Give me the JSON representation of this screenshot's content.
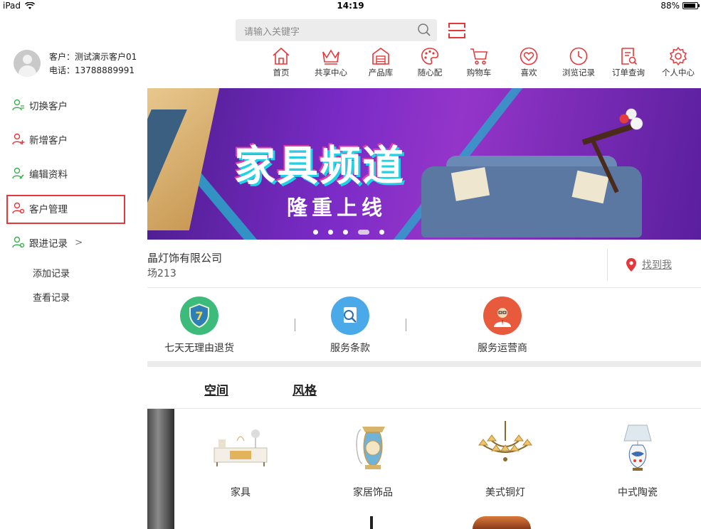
{
  "status_bar": {
    "device": "iPad",
    "time": "14:19",
    "battery": "88%",
    "battery_level": 0.88
  },
  "sidebar": {
    "customer_label": "客户：测试演示客户01",
    "phone_label": "电话：13788889991",
    "menu": [
      {
        "label": "切换客户",
        "icon": "switch-user-icon"
      },
      {
        "label": "新增客户",
        "icon": "add-user-icon"
      },
      {
        "label": "编辑资料",
        "icon": "edit-user-icon"
      },
      {
        "label": "客户管理",
        "icon": "manage-user-icon",
        "highlighted": true
      },
      {
        "label": "跟进记录",
        "icon": "followup-user-icon",
        "chevron": ">"
      }
    ],
    "sub_menu": [
      {
        "label": "添加记录"
      },
      {
        "label": "查看记录"
      }
    ]
  },
  "search": {
    "placeholder": "请输入关键字"
  },
  "nav": [
    {
      "label": "首页",
      "icon": "home-icon"
    },
    {
      "label": "共享中心",
      "icon": "crown-icon"
    },
    {
      "label": "产品库",
      "icon": "warehouse-icon"
    },
    {
      "label": "随心配",
      "icon": "palette-icon"
    },
    {
      "label": "购物车",
      "icon": "cart-icon"
    },
    {
      "label": "喜欢",
      "icon": "heart-icon"
    },
    {
      "label": "浏览记录",
      "icon": "clock-icon"
    },
    {
      "label": "订单查询",
      "icon": "order-icon"
    },
    {
      "label": "个人中心",
      "icon": "gear-icon"
    }
  ],
  "banner": {
    "title": "家具频道",
    "subtitle": "隆重上线",
    "dot_count": 5,
    "active_dot": 3
  },
  "store": {
    "name": "晶灯饰有限公司",
    "address": "场213",
    "locate_label": "找到我"
  },
  "services": [
    {
      "label": "七天无理由退货",
      "icon": "shield-7-icon",
      "color": "#3dbb7a"
    },
    {
      "label": "服务条款",
      "icon": "document-search-icon",
      "color": "#4aa9e8"
    },
    {
      "label": "服务运营商",
      "icon": "operator-avatar-icon",
      "color": "#e85a3c"
    }
  ],
  "tabs": [
    {
      "label": "空间"
    },
    {
      "label": "风格"
    }
  ],
  "categories": [
    {
      "label": "家具",
      "icon": "tv-cabinet-icon"
    },
    {
      "label": "家居饰品",
      "icon": "phone-ornament-icon"
    },
    {
      "label": "美式铜灯",
      "icon": "chandelier-icon"
    },
    {
      "label": "中式陶瓷",
      "icon": "table-lamp-icon"
    }
  ],
  "colors": {
    "accent_red": "#e5383b",
    "menu_green": "#3dae4f",
    "menu_red": "#e5383b"
  }
}
